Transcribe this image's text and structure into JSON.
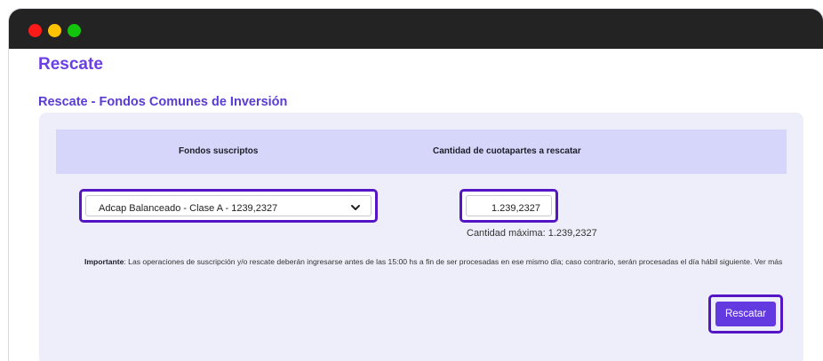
{
  "page": {
    "title": "Rescate",
    "section_title": "Rescate - Fondos Comunes de Inversión"
  },
  "table": {
    "headers": [
      "Fondos suscriptos",
      "Cantidad de cuotapartes a rescatar"
    ]
  },
  "form": {
    "fund_select": {
      "selected": "Adcap Balanceado - Clase A - 1239,2327"
    },
    "quantity": {
      "value": "1.239,2327"
    },
    "max_label": "Cantidad máxima: 1.239,2327"
  },
  "notice": {
    "label": "Importante",
    "text": ": Las operaciones de suscripción y/o rescate deberán ingresarse antes de las 15:00 hs a fin de ser procesadas en ese mismo día; caso contrario, serán procesadas el día hábil siguiente. Ver más"
  },
  "actions": {
    "submit_label": "Rescatar"
  },
  "colors": {
    "accent": "#6339e0",
    "highlight": "#5416c4",
    "header_bg": "#d6d6fb",
    "card_bg": "#eeeefa"
  }
}
